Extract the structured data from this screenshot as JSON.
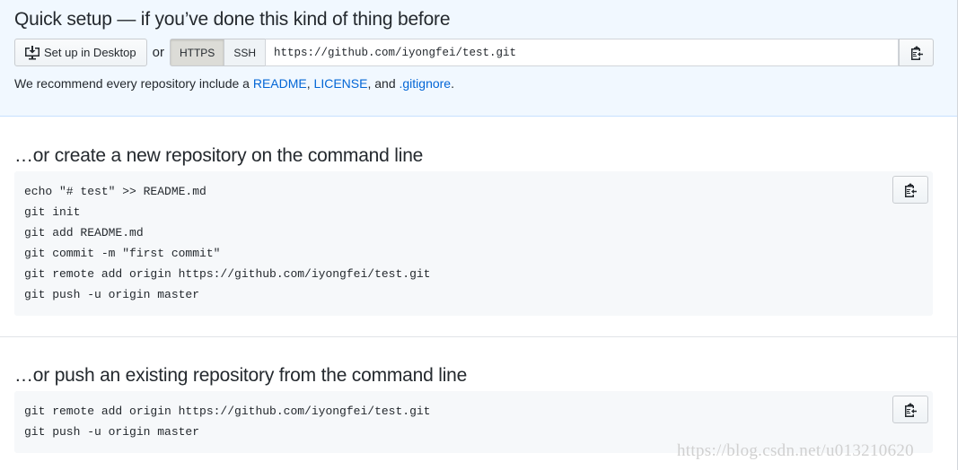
{
  "quick": {
    "title": "Quick setup — if you’ve done this kind of thing before",
    "desktop_label": "Set up in Desktop",
    "or": "or",
    "https": "HTTPS",
    "ssh": "SSH",
    "url": "https://github.com/iyongfei/test.git",
    "rec_prefix": "We recommend every repository include a ",
    "readme": "README",
    "comma": ", ",
    "license": "LICENSE",
    "and": ", and ",
    "gitignore": ".gitignore",
    "period": "."
  },
  "create": {
    "title": "…or create a new repository on the command line",
    "lines": [
      "echo \"# test\" >> README.md",
      "git init",
      "git add README.md",
      "git commit -m \"first commit\"",
      "git remote add origin https://github.com/iyongfei/test.git",
      "git push -u origin master"
    ]
  },
  "push": {
    "title": "…or push an existing repository from the command line",
    "lines": [
      "git remote add origin https://github.com/iyongfei/test.git",
      "git push -u origin master"
    ]
  },
  "watermark": "https://blog.csdn.net/u013210620",
  "icons": {
    "desktop": "desktop-download-icon",
    "copy": "clipboard-icon"
  },
  "colors": {
    "link": "#0366d6",
    "quick_bg": "#f1f8ff"
  }
}
